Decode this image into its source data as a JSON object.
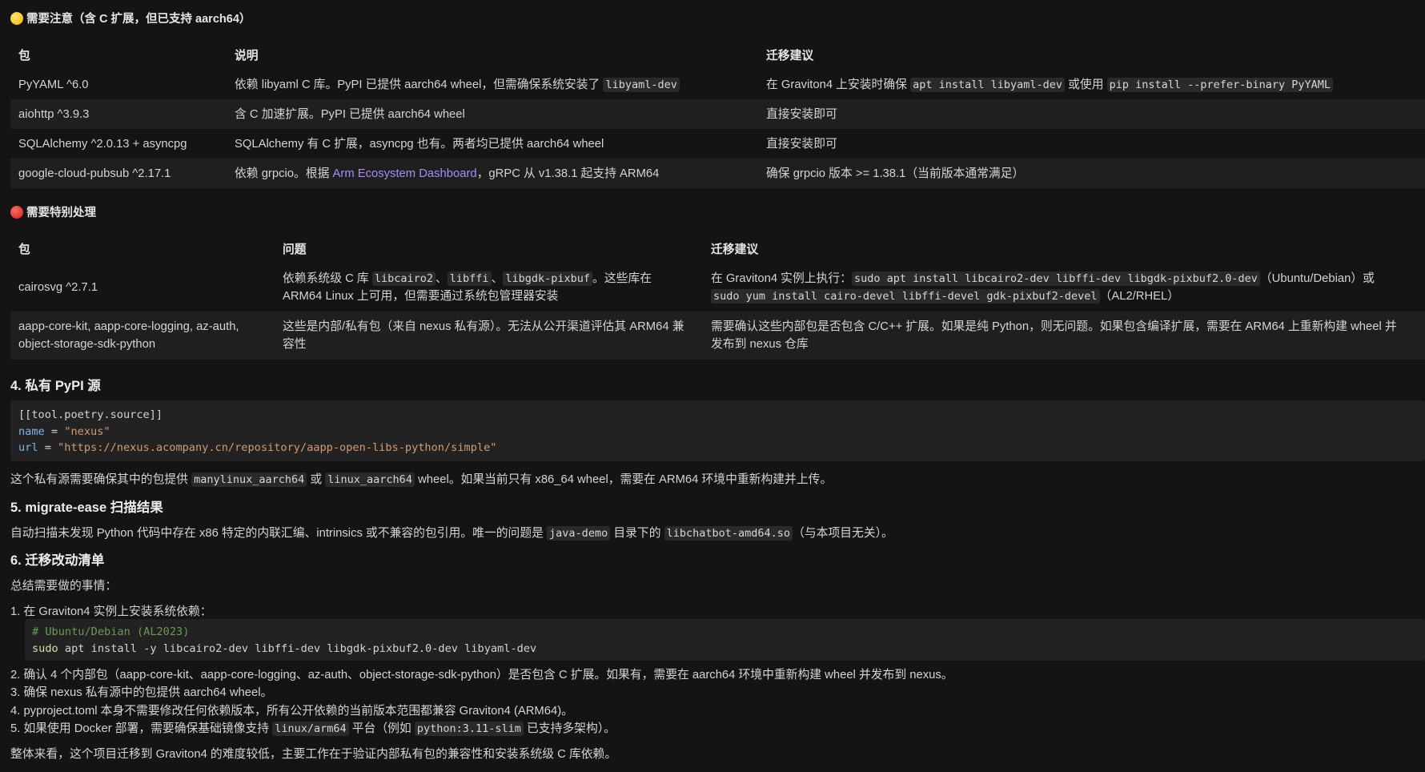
{
  "section_attention": {
    "title": "需要注意（含 C 扩展，但已支持 aarch64）",
    "columns": [
      "包",
      "说明",
      "迁移建议"
    ],
    "rows": [
      {
        "pkg": "PyYAML ^6.0",
        "desc_prefix": "依赖 libyaml C 库。PyPI 已提供 aarch64 wheel，但需确保系统安装了 ",
        "desc_code": "libyaml-dev",
        "adv_prefix": "在 Graviton4 上安装时确保 ",
        "adv_code1": "apt install libyaml-dev",
        "adv_mid": " 或使用 ",
        "adv_code2": "pip install --prefer-binary PyYAML"
      },
      {
        "pkg": "aiohttp ^3.9.3",
        "desc": "含 C 加速扩展。PyPI 已提供 aarch64 wheel",
        "adv": "直接安装即可"
      },
      {
        "pkg": "SQLAlchemy ^2.0.13 + asyncpg",
        "desc": "SQLAlchemy 有 C 扩展，asyncpg 也有。两者均已提供 aarch64 wheel",
        "adv": "直接安装即可"
      },
      {
        "pkg": "google-cloud-pubsub ^2.17.1",
        "desc_prefix": "依赖 grpcio。根据 ",
        "desc_link": "Arm Ecosystem Dashboard",
        "desc_suffix": "，gRPC 从 v1.38.1 起支持 ARM64",
        "adv": "确保 grpcio 版本 >= 1.38.1（当前版本通常满足）"
      }
    ]
  },
  "section_special": {
    "title": "需要特别处理",
    "columns": [
      "包",
      "问题",
      "迁移建议"
    ],
    "rows": [
      {
        "pkg": "cairosvg ^2.7.1",
        "issue_prefix": "依赖系统级 C 库 ",
        "issue_code1": "libcairo2",
        "issue_sep1": "、",
        "issue_code2": "libffi",
        "issue_sep2": "、",
        "issue_code3": "libgdk-pixbuf",
        "issue_suffix": "。这些库在",
        "issue_line2": "ARM64 Linux 上可用，但需要通过系统包管理器安装",
        "adv_prefix": "在 Graviton4 实例上执行：",
        "adv_code1": "sudo apt install libcairo2-dev libffi-dev libgdk-pixbuf2.0-dev",
        "adv_mid": "（Ubuntu/Debian）或",
        "adv_code2": "sudo yum install cairo-devel libffi-devel gdk-pixbuf2-devel",
        "adv_suffix": "（AL2/RHEL）"
      },
      {
        "pkg_line1": "aapp-core-kit, aapp-core-logging, az-auth,",
        "pkg_line2": "object-storage-sdk-python",
        "issue_line1": "这些是内部/私有包（来自 nexus 私有源）。无法从公开渠道评估其 ARM64 兼",
        "issue_line2": "容性",
        "adv_line1": "需要确认这些内部包是否包含 C/C++ 扩展。如果是纯 Python，则无问题。如果包含编译扩展，需要在 ARM64 上重新构建 wheel 并",
        "adv_line2": "发布到 nexus 仓库"
      }
    ]
  },
  "sec4": {
    "title": "4. 私有 PyPI 源",
    "code_line1": "[[tool.poetry.source]]",
    "code_name_key": "name",
    "code_eq": " = ",
    "code_name_val": "\"nexus\"",
    "code_url_key": "url",
    "code_url_val": "\"https://nexus.acompany.cn/repository/aapp-open-libs-python/simple\"",
    "para_prefix": "这个私有源需要确保其中的包提供 ",
    "para_code1": "manylinux_aarch64",
    "para_mid": " 或 ",
    "para_code2": "linux_aarch64",
    "para_suffix": " wheel。如果当前只有 x86_64 wheel，需要在 ARM64 环境中重新构建并上传。"
  },
  "sec5": {
    "title": "5. migrate-ease 扫描结果",
    "para_prefix": "自动扫描未发现 Python 代码中存在 x86 特定的内联汇编、intrinsics 或不兼容的包引用。唯一的问题是 ",
    "para_code1": "java-demo",
    "para_mid": " 目录下的 ",
    "para_code2": "libchatbot-amd64.so",
    "para_suffix": "（与本项目无关）。"
  },
  "sec6": {
    "title": "6. 迁移改动清单",
    "intro": "总结需要做的事情：",
    "item1": "1. 在 Graviton4 实例上安装系统依赖：",
    "code_comment": "# Ubuntu/Debian (AL2023)",
    "code_cmd": "sudo",
    "code_rest": " apt install -y libcairo2-dev libffi-dev libgdk-pixbuf2.0-dev libyaml-dev",
    "item2": "2. 确认 4 个内部包（aapp-core-kit、aapp-core-logging、az-auth、object-storage-sdk-python）是否包含 C 扩展。如果有，需要在 aarch64 环境中重新构建 wheel 并发布到 nexus。",
    "item3": "3. 确保 nexus 私有源中的包提供 aarch64 wheel。",
    "item4": "4. pyproject.toml 本身不需要修改任何依赖版本，所有公开依赖的当前版本范围都兼容 Graviton4 (ARM64)。",
    "item5_prefix": "5. 如果使用 Docker 部署，需要确保基础镜像支持 ",
    "item5_code1": "linux/arm64",
    "item5_mid": " 平台（例如 ",
    "item5_code2": "python:3.11-slim",
    "item5_suffix": " 已支持多架构）。",
    "summary": "整体来看，这个项目迁移到 Graviton4 的难度较低，主要工作在于验证内部私有包的兼容性和安装系统级 C 库依赖。"
  }
}
